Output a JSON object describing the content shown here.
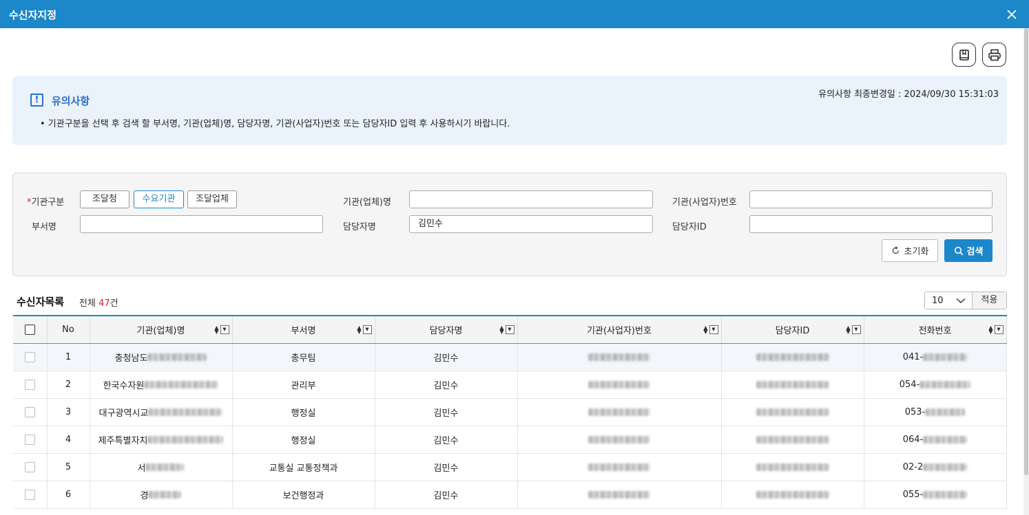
{
  "window": {
    "title": "수신자지정"
  },
  "notice": {
    "icon": "!",
    "title": "유의사항",
    "updated": "유의사항 최종변경일 : 2024/09/30 15:31:03",
    "text": "• 기관구분을 선택 후 검색 할 부서명, 기관(업체)명, 담당자명, 기관(사업자)번호 또는 담당자ID  입력 후 사용하시기 바랍니다."
  },
  "search": {
    "org_type_required": "*",
    "org_type_label": "기관구분",
    "org_types": [
      "조달청",
      "수요기관",
      "조달업체"
    ],
    "org_type_selected": "수요기관",
    "org_name_label": "기관(업체)명",
    "org_name_value": "",
    "biz_no_label": "기관(사업자)번호",
    "biz_no_value": "",
    "dept_label": "부서명",
    "dept_value": "",
    "manager_label": "담당자명",
    "manager_value": "김민수",
    "manager_id_label": "담당자ID",
    "manager_id_value": "",
    "reset_label": "초기화",
    "search_label": "검색"
  },
  "list": {
    "title": "수신자목록",
    "total_label": "전체",
    "total_count": "47",
    "total_unit": "건",
    "page_size": "10",
    "apply_label": "적용",
    "columns": [
      "No",
      "기관(업체)명",
      "부서명",
      "담당자명",
      "기관(사업자)번호",
      "담당자ID",
      "전화번호"
    ],
    "rows": [
      {
        "no": "1",
        "org": "충청남도",
        "dept": "총무팀",
        "manager": "김민수",
        "phone": "041-"
      },
      {
        "no": "2",
        "org": "한국수자원",
        "dept": "관리부",
        "manager": "김민수",
        "phone": "054-"
      },
      {
        "no": "3",
        "org": "대구광역시교",
        "dept": "행정실",
        "manager": "김민수",
        "phone": "053-"
      },
      {
        "no": "4",
        "org": "제주특별자치",
        "dept": "행정실",
        "manager": "김민수",
        "phone": "064-"
      },
      {
        "no": "5",
        "org": "서",
        "dept": "교통실 교통정책과",
        "manager": "김민수",
        "phone": "02-2"
      },
      {
        "no": "6",
        "org": "경",
        "dept": "보건행정과",
        "manager": "김민수",
        "phone": "055-"
      }
    ]
  },
  "colors": {
    "primary": "#1c87c9",
    "accent_red": "#d9232d",
    "notice_bg": "#eaf2fb"
  }
}
